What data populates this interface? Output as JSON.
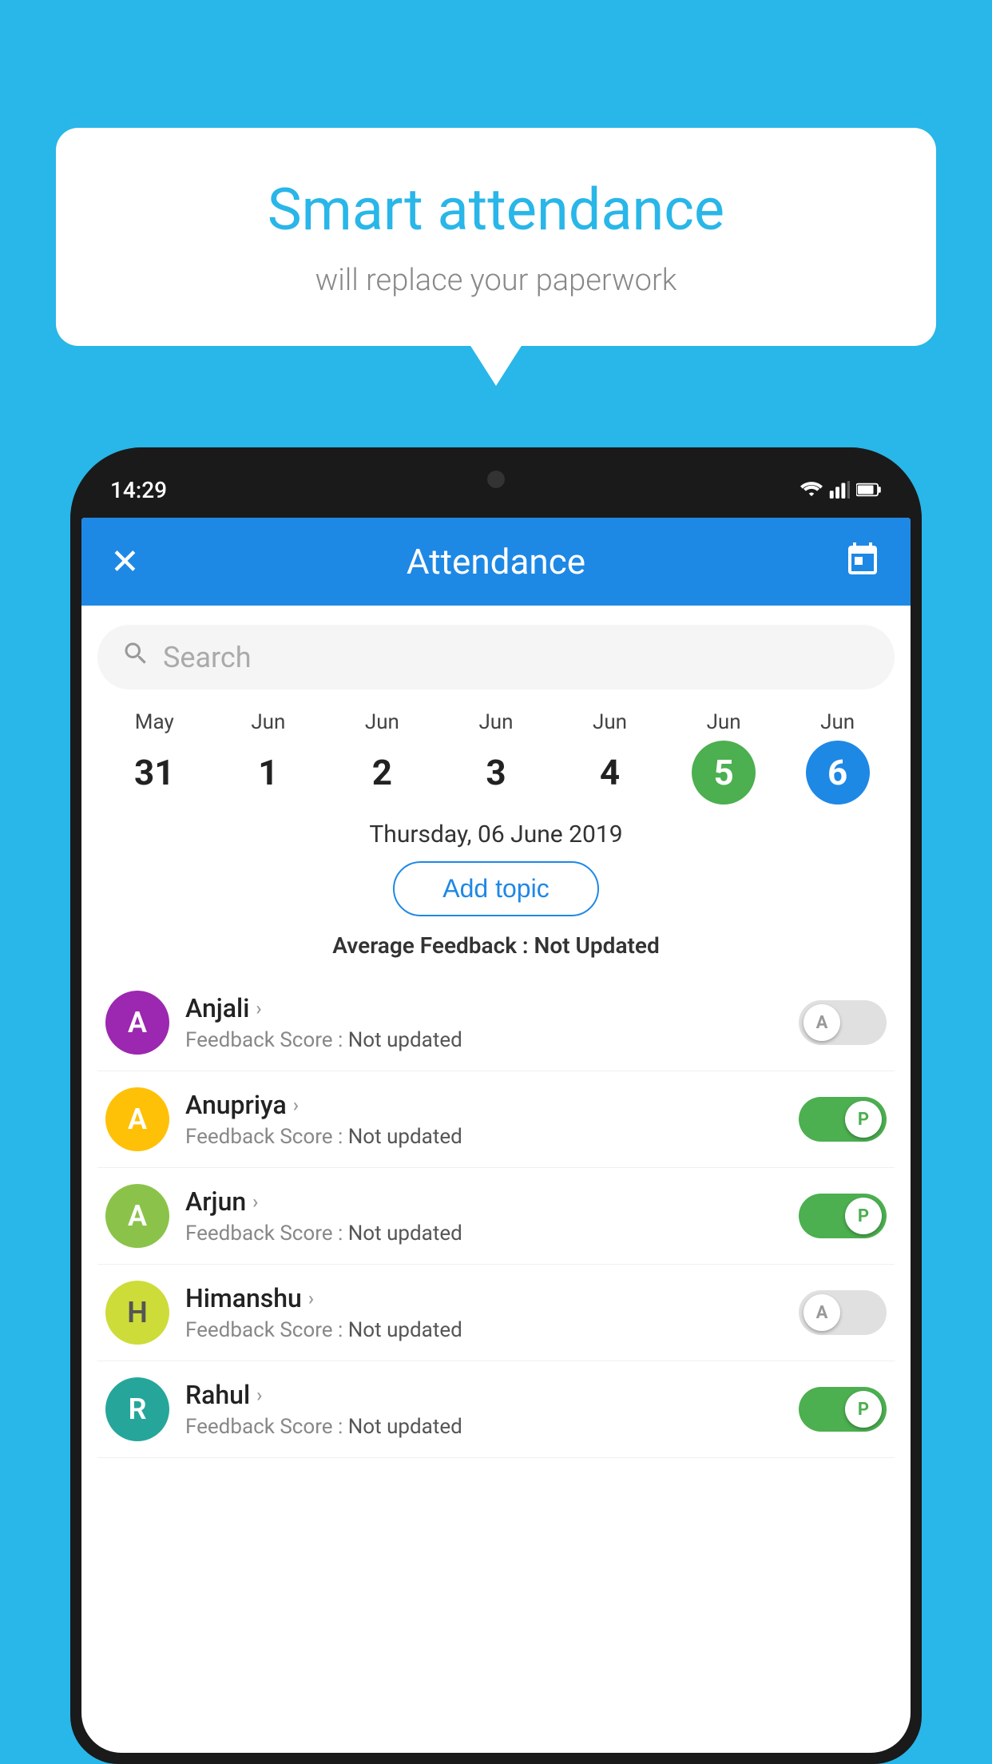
{
  "background_color": "#29B6E8",
  "bubble": {
    "title": "Smart attendance",
    "subtitle": "will replace your paperwork"
  },
  "status_bar": {
    "time": "14:29",
    "icons": [
      "wifi",
      "signal",
      "battery"
    ]
  },
  "header": {
    "close_label": "✕",
    "title": "Attendance",
    "calendar_icon": "calendar"
  },
  "search": {
    "placeholder": "Search"
  },
  "calendar": {
    "days": [
      {
        "month": "May",
        "num": "31",
        "state": "normal"
      },
      {
        "month": "Jun",
        "num": "1",
        "state": "normal"
      },
      {
        "month": "Jun",
        "num": "2",
        "state": "normal"
      },
      {
        "month": "Jun",
        "num": "3",
        "state": "normal"
      },
      {
        "month": "Jun",
        "num": "4",
        "state": "normal"
      },
      {
        "month": "Jun",
        "num": "5",
        "state": "today"
      },
      {
        "month": "Jun",
        "num": "6",
        "state": "selected"
      }
    ]
  },
  "selected_date": "Thursday, 06 June 2019",
  "add_topic_label": "Add topic",
  "avg_feedback_label": "Average Feedback :",
  "avg_feedback_value": "Not Updated",
  "students": [
    {
      "name": "Anjali",
      "avatar_letter": "A",
      "avatar_color": "purple",
      "feedback": "Not updated",
      "attendance": "A",
      "toggle_state": "off"
    },
    {
      "name": "Anupriya",
      "avatar_letter": "A",
      "avatar_color": "amber",
      "feedback": "Not updated",
      "attendance": "P",
      "toggle_state": "on"
    },
    {
      "name": "Arjun",
      "avatar_letter": "A",
      "avatar_color": "light-green",
      "feedback": "Not updated",
      "attendance": "P",
      "toggle_state": "on"
    },
    {
      "name": "Himanshu",
      "avatar_letter": "H",
      "avatar_color": "lime",
      "feedback": "Not updated",
      "attendance": "A",
      "toggle_state": "off"
    },
    {
      "name": "Rahul",
      "avatar_letter": "R",
      "avatar_color": "teal",
      "feedback": "Not updated",
      "attendance": "P",
      "toggle_state": "on"
    }
  ]
}
